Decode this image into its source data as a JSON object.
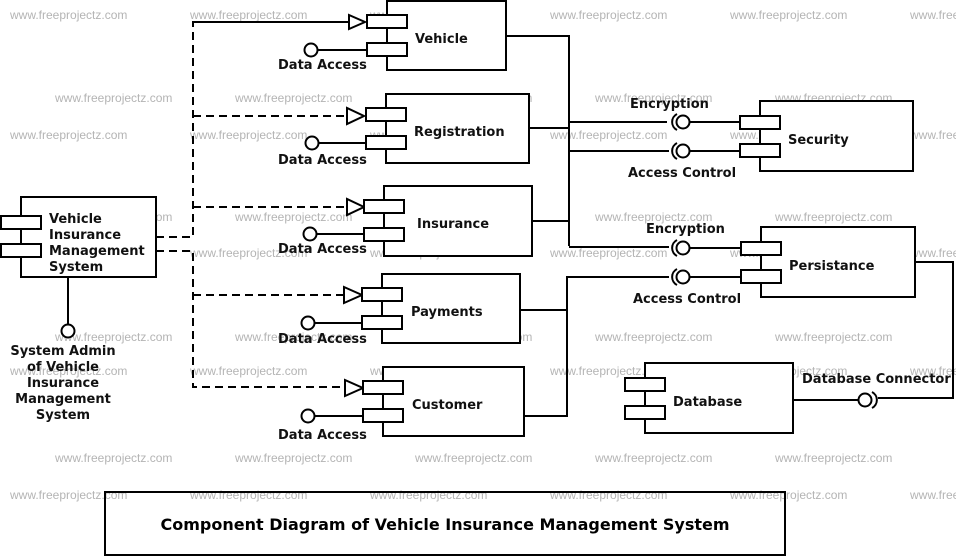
{
  "watermark": "www.freeprojectz.com",
  "diagram_title": "Component Diagram of Vehicle Insurance Management System",
  "system": {
    "name_lines": [
      "Vehicle",
      "Insurance",
      "Management",
      "System"
    ],
    "interface_lines": [
      "System Admin",
      "of Vehicle",
      "Insurance",
      "Management",
      "System"
    ]
  },
  "modules": [
    {
      "id": "vehicle",
      "name": "Vehicle",
      "interface": "Data Access"
    },
    {
      "id": "registration",
      "name": "Registration",
      "interface": "Data Access"
    },
    {
      "id": "insurance",
      "name": "Insurance",
      "interface": "Data Access"
    },
    {
      "id": "payments",
      "name": "Payments",
      "interface": "Data Access"
    },
    {
      "id": "customer",
      "name": "Customer",
      "interface": "Data Access"
    }
  ],
  "services": [
    {
      "id": "security",
      "name": "Security",
      "interfaces": [
        "Encryption",
        "Access Control"
      ]
    },
    {
      "id": "persistance",
      "name": "Persistance",
      "interfaces": [
        "Encryption",
        "Access Control"
      ]
    }
  ],
  "database": {
    "name": "Database",
    "interface": "Database Connector"
  }
}
